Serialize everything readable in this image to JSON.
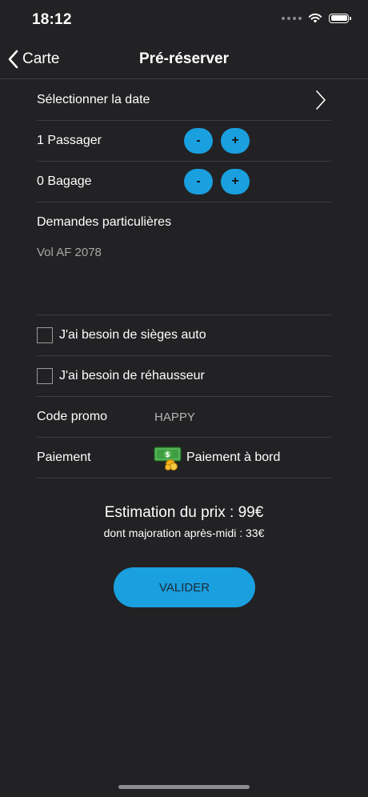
{
  "status_bar": {
    "time": "18:12"
  },
  "nav": {
    "back_label": "Carte",
    "title": "Pré-réserver"
  },
  "form": {
    "date_label": "Sélectionner la date",
    "passengers_label": "1 Passager",
    "luggage_label": "0 Bagage",
    "minus_label": "-",
    "plus_label": "+",
    "special_requests_label": "Demandes particulières",
    "special_requests_value": "Vol AF 2078",
    "car_seat_label": "J'ai besoin de sièges auto",
    "booster_label": "J'ai besoin de réhausseur",
    "promo_label": "Code promo",
    "promo_value": "HAPPY",
    "payment_label": "Paiement",
    "payment_value": "Paiement à bord",
    "payment_icon": "money-icon"
  },
  "estimate": {
    "price_text": "Estimation du prix : 99€",
    "surcharge_text": "dont majoration après-midi : 33€"
  },
  "actions": {
    "validate_label": "VALIDER"
  },
  "colors": {
    "accent": "#1a9fdf",
    "background": "#222224",
    "divider": "#3d3d40"
  }
}
